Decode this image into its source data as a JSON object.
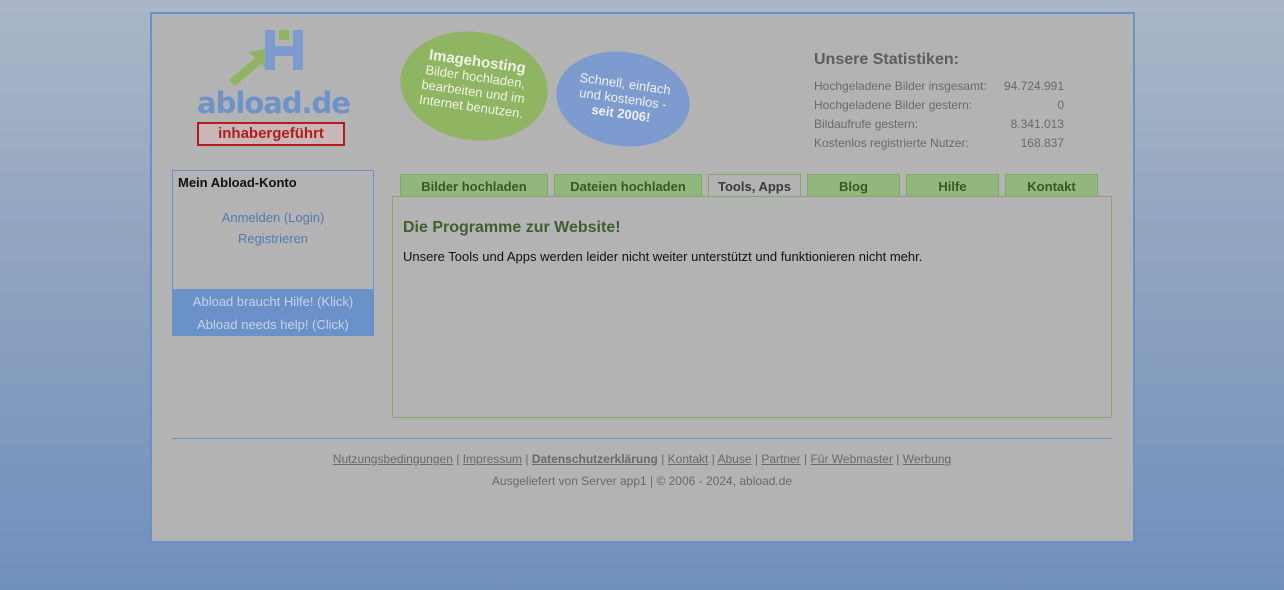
{
  "logo": {
    "text": "abload.de",
    "badge": "inhabergeführt"
  },
  "stickers": {
    "green": {
      "heading": "Imagehosting",
      "lines": [
        "Bilder hochladen,",
        "bearbeiten und im",
        "Internet benutzen."
      ]
    },
    "blue": {
      "lines": [
        "Schnell, einfach",
        "und kostenlos -"
      ],
      "bold": "seit 2006!"
    }
  },
  "stats": {
    "title": "Unsere Statistiken:",
    "rows": [
      {
        "label": "Hochgeladene Bilder insgesamt:",
        "value": "94.724.991"
      },
      {
        "label": "Hochgeladene Bilder gestern:",
        "value": "0"
      },
      {
        "label": "Bildaufrufe gestern:",
        "value": "8.341.013"
      },
      {
        "label": "Kostenlos registrierte Nutzer:",
        "value": "168.837"
      }
    ]
  },
  "account": {
    "title": "Mein Abload-Konto",
    "login": "Anmelden (Login)",
    "register": "Registrieren"
  },
  "help": {
    "de": "Abload braucht Hilfe! (Klick)",
    "en": "Abload needs help! (Click)"
  },
  "tabs": [
    "Bilder hochladen",
    "Dateien hochladen",
    "Tools, Apps",
    "Blog",
    "Hilfe",
    "Kontakt"
  ],
  "content": {
    "heading": "Die Programme zur Website!",
    "text": "Unsere Tools und Apps werden leider nicht weiter unterstützt und funktionieren nicht mehr."
  },
  "footer": {
    "links": [
      "Nutzungsbedingungen",
      "Impressum",
      "Datenschutzerklärung",
      "Kontakt",
      "Abuse",
      "Partner",
      "Für Webmaster",
      "Werbung"
    ],
    "note": "Ausgeliefert von Server app1 | © 2006 - 2024, abload.de"
  },
  "colors": {
    "accent": "#6a91c8",
    "green": "#92b77d",
    "heading": "#3f5f30"
  }
}
